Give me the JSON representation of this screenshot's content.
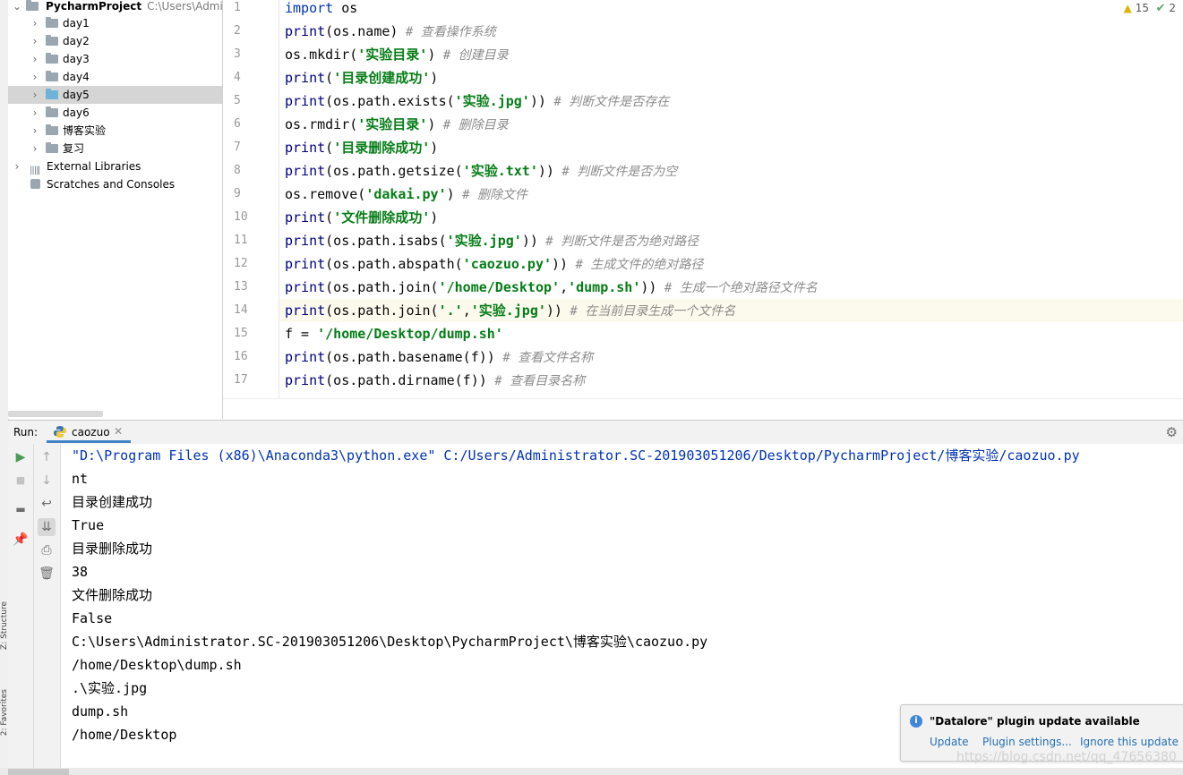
{
  "project": {
    "root_name": "PycharmProject",
    "root_path": "C:\\Users\\Admini",
    "items": [
      {
        "label": "day1"
      },
      {
        "label": "day2"
      },
      {
        "label": "day3"
      },
      {
        "label": "day4"
      },
      {
        "label": "day5"
      },
      {
        "label": "day6"
      },
      {
        "label": "博客实验"
      },
      {
        "label": "复习"
      }
    ],
    "external_libraries": "External Libraries",
    "scratches": "Scratches and Consoles"
  },
  "side_labels": {
    "structure": "Z: Structure",
    "favorites": "2: Favorites"
  },
  "editor": {
    "inspections": {
      "warnings": "15",
      "ok": "2"
    },
    "line_numbers": [
      "1",
      "2",
      "3",
      "4",
      "5",
      "6",
      "7",
      "8",
      "9",
      "10",
      "11",
      "12",
      "13",
      "14",
      "15",
      "16",
      "17"
    ],
    "lines": [
      [
        {
          "t": "import",
          "c": "kw"
        },
        {
          "t": " os",
          "c": "pl"
        }
      ],
      [
        {
          "t": "print",
          "c": "bi"
        },
        {
          "t": "(os.name)",
          "c": "pl"
        },
        {
          "t": " # 查看操作系统",
          "c": "cm"
        }
      ],
      [
        {
          "t": "os.mkdir(",
          "c": "pl"
        },
        {
          "t": "'实验目录'",
          "c": "str"
        },
        {
          "t": ")",
          "c": "pl"
        },
        {
          "t": " # 创建目录",
          "c": "cm"
        }
      ],
      [
        {
          "t": "print",
          "c": "bi"
        },
        {
          "t": "(",
          "c": "pl"
        },
        {
          "t": "'目录创建成功'",
          "c": "str"
        },
        {
          "t": ")",
          "c": "pl"
        }
      ],
      [
        {
          "t": "print",
          "c": "bi"
        },
        {
          "t": "(os.path.exists(",
          "c": "pl"
        },
        {
          "t": "'实验.jpg'",
          "c": "str"
        },
        {
          "t": "))",
          "c": "pl"
        },
        {
          "t": " # 判断文件是否存在",
          "c": "cm"
        }
      ],
      [
        {
          "t": "os.rmdir(",
          "c": "pl"
        },
        {
          "t": "'实验目录'",
          "c": "str"
        },
        {
          "t": ")",
          "c": "pl"
        },
        {
          "t": " # 删除目录",
          "c": "cm"
        }
      ],
      [
        {
          "t": "print",
          "c": "bi"
        },
        {
          "t": "(",
          "c": "pl"
        },
        {
          "t": "'目录删除成功'",
          "c": "str"
        },
        {
          "t": ")",
          "c": "pl"
        }
      ],
      [
        {
          "t": "print",
          "c": "bi"
        },
        {
          "t": "(os.path.getsize(",
          "c": "pl"
        },
        {
          "t": "'实验.txt'",
          "c": "str"
        },
        {
          "t": "))",
          "c": "pl"
        },
        {
          "t": " # 判断文件是否为空",
          "c": "cm"
        }
      ],
      [
        {
          "t": "os.remove(",
          "c": "pl"
        },
        {
          "t": "'dakai.py'",
          "c": "str"
        },
        {
          "t": ")",
          "c": "pl"
        },
        {
          "t": " # 删除文件",
          "c": "cm"
        }
      ],
      [
        {
          "t": "print",
          "c": "bi"
        },
        {
          "t": "(",
          "c": "pl"
        },
        {
          "t": "'文件删除成功'",
          "c": "str"
        },
        {
          "t": ")",
          "c": "pl"
        }
      ],
      [
        {
          "t": "print",
          "c": "bi"
        },
        {
          "t": "(os.path.isabs(",
          "c": "pl"
        },
        {
          "t": "'实验.jpg'",
          "c": "str"
        },
        {
          "t": "))",
          "c": "pl"
        },
        {
          "t": " # 判断文件是否为绝对路径",
          "c": "cm"
        }
      ],
      [
        {
          "t": "print",
          "c": "bi"
        },
        {
          "t": "(os.path.abspath(",
          "c": "pl"
        },
        {
          "t": "'caozuo.py'",
          "c": "str"
        },
        {
          "t": "))",
          "c": "pl"
        },
        {
          "t": " # 生成文件的绝对路径",
          "c": "cm"
        }
      ],
      [
        {
          "t": "print",
          "c": "bi"
        },
        {
          "t": "(os.path.join(",
          "c": "pl"
        },
        {
          "t": "'/home/Desktop'",
          "c": "str"
        },
        {
          "t": ",",
          "c": "pl"
        },
        {
          "t": "'dump.sh'",
          "c": "str"
        },
        {
          "t": "))",
          "c": "pl"
        },
        {
          "t": " # 生成一个绝对路径文件名",
          "c": "cm"
        }
      ],
      [
        {
          "t": "print",
          "c": "bi"
        },
        {
          "t": "(os.path.join(",
          "c": "pl"
        },
        {
          "t": "'.'",
          "c": "str"
        },
        {
          "t": ",",
          "c": "pl"
        },
        {
          "t": "'实验.jpg'",
          "c": "str"
        },
        {
          "t": "))",
          "c": "pl"
        },
        {
          "t": " # 在当前目录生成一个文件名",
          "c": "cm"
        }
      ],
      [
        {
          "t": "f = ",
          "c": "pl"
        },
        {
          "t": "'/home/Desktop/dump.sh'",
          "c": "str"
        }
      ],
      [
        {
          "t": "print",
          "c": "bi"
        },
        {
          "t": "(os.path.basename(f))",
          "c": "pl"
        },
        {
          "t": " # 查看文件名称",
          "c": "cm"
        }
      ],
      [
        {
          "t": "print",
          "c": "bi"
        },
        {
          "t": "(os.path.dirname(f))",
          "c": "pl"
        },
        {
          "t": " # 查看目录名称",
          "c": "cm"
        }
      ]
    ]
  },
  "run": {
    "label": "Run:",
    "tab_name": "caozuo",
    "output": [
      "\"D:\\Program Files (x86)\\Anaconda3\\python.exe\" C:/Users/Administrator.SC-201903051206/Desktop/PycharmProject/博客实验/caozuo.py",
      "nt",
      "目录创建成功",
      "True",
      "目录删除成功",
      "38",
      "文件删除成功",
      "False",
      "C:\\Users\\Administrator.SC-201903051206\\Desktop\\PycharmProject\\博客实验\\caozuo.py",
      "/home/Desktop\\dump.sh",
      ".\\实验.jpg",
      "dump.sh",
      "/home/Desktop"
    ]
  },
  "notification": {
    "title": "\"Datalore\" plugin update available",
    "update": "Update",
    "settings": "Plugin settings...",
    "ignore": "Ignore this update"
  },
  "watermark": "https://blog.csdn.net/qq_47656380"
}
